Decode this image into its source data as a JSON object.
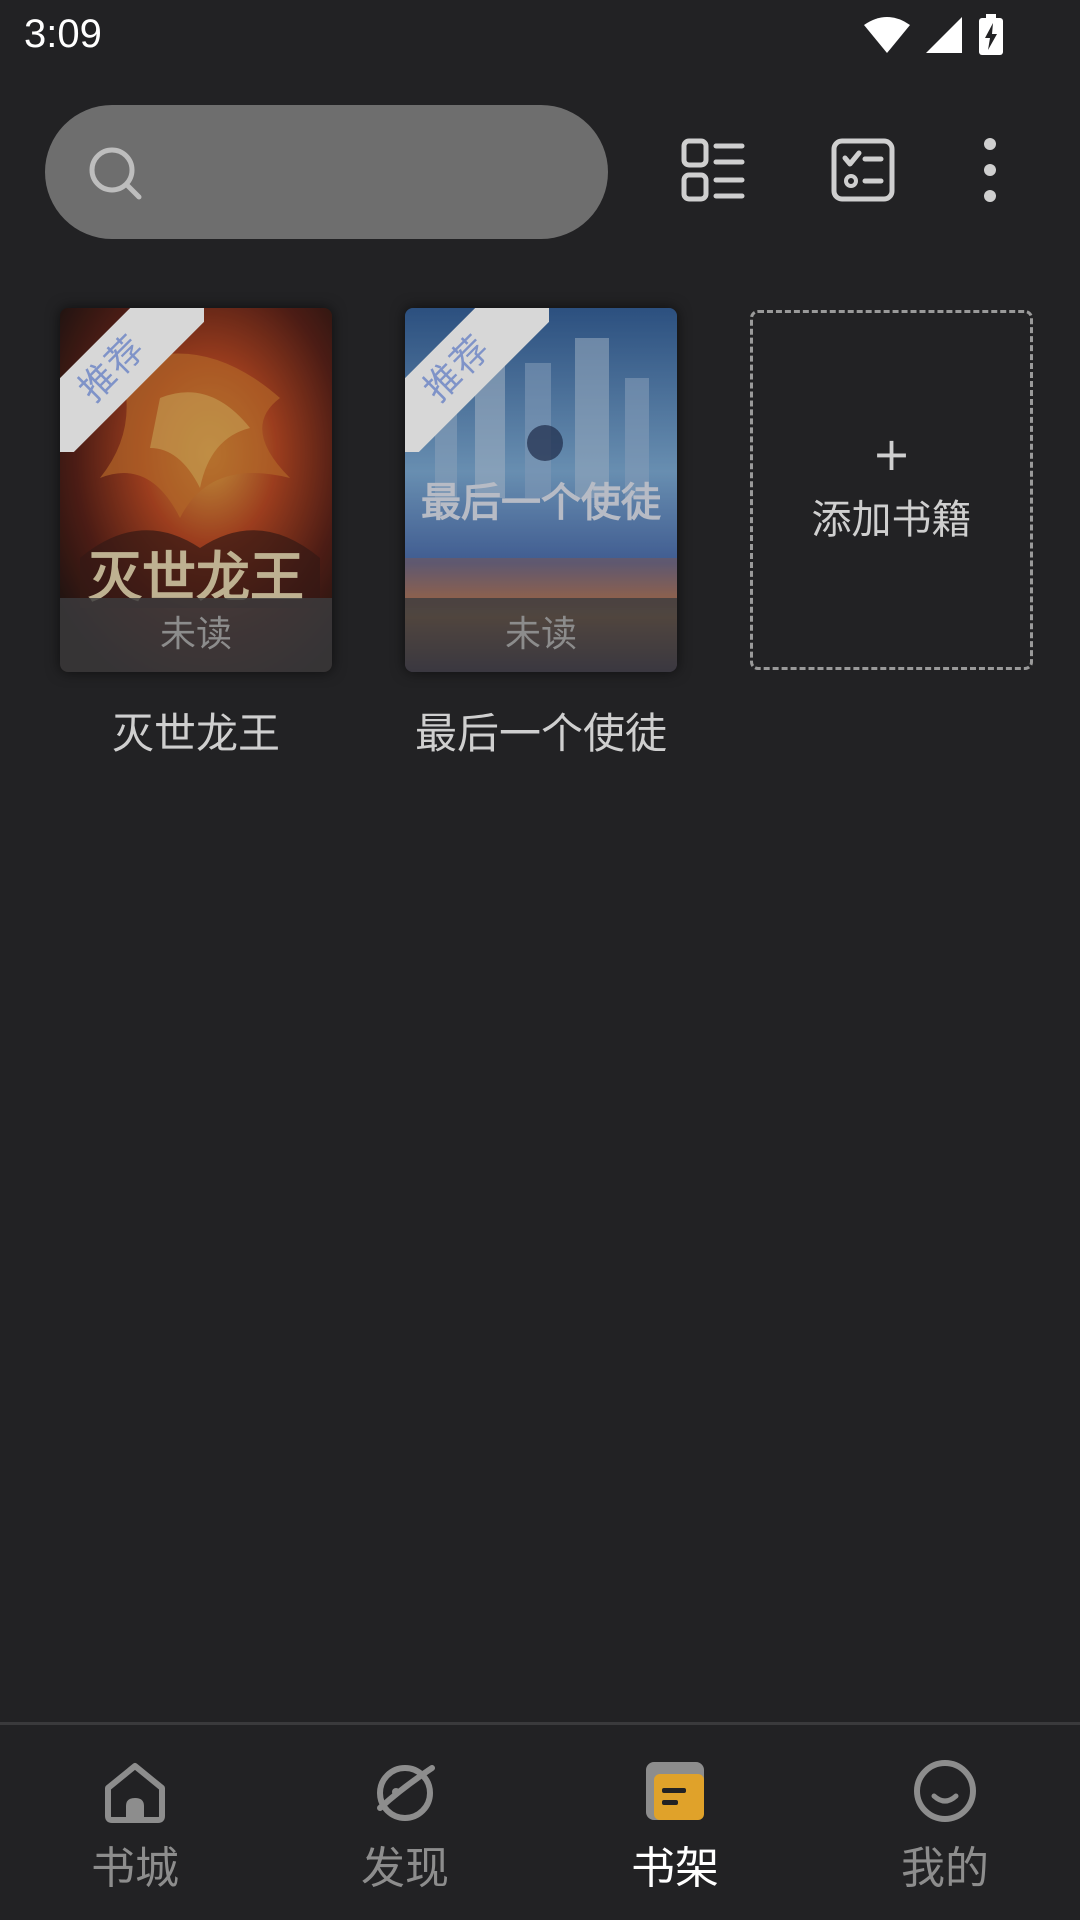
{
  "status_bar": {
    "time": "3:09"
  },
  "toolbar": {
    "search_icon": "search-icon",
    "layout_icon": "list-layout-icon",
    "manage_icon": "checklist-icon",
    "more_icon": "more-vertical-icon"
  },
  "books": [
    {
      "title": "灭世龙王",
      "cover_title": "灭世龙王",
      "ribbon": "推荐",
      "status": "未读"
    },
    {
      "title": "最后一个使徒",
      "cover_title": "最后一个使徒",
      "ribbon": "推荐",
      "status": "未读"
    }
  ],
  "add_book": {
    "plus": "+",
    "label": "添加书籍"
  },
  "bottom_nav": {
    "items": [
      {
        "label": "书城",
        "icon": "home-icon",
        "active": false
      },
      {
        "label": "发现",
        "icon": "planet-icon",
        "active": false
      },
      {
        "label": "书架",
        "icon": "bookshelf-icon",
        "active": true
      },
      {
        "label": "我的",
        "icon": "profile-icon",
        "active": false
      }
    ]
  },
  "colors": {
    "background": "#222224",
    "search_bg": "#6e6e6e",
    "active_accent": "#e0a22a",
    "ribbon_text": "#7f93c8"
  }
}
